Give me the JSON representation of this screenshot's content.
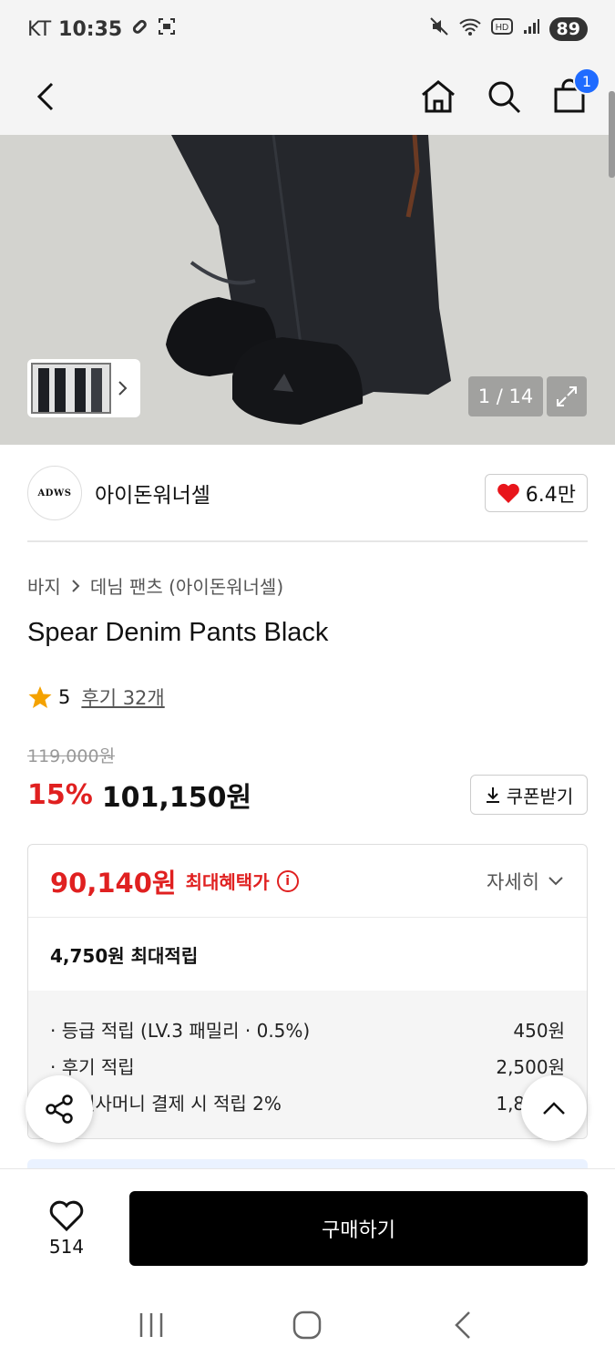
{
  "status": {
    "carrier": "KT",
    "time": "10:35",
    "battery": "89"
  },
  "nav": {
    "cart_count": "1"
  },
  "gallery": {
    "counter": "1 / 14"
  },
  "brand": {
    "logo_text": "ADWS",
    "name": "아이돈워너셀",
    "likes": "6.4만"
  },
  "breadcrumb": {
    "category": "바지",
    "sub": "데님 팬츠 (아이돈워너셀)"
  },
  "product": {
    "title": "Spear Denim Pants Black",
    "rating": "5",
    "reviews": "후기 32개"
  },
  "price": {
    "original": "119,000원",
    "discount": "15%",
    "sale": "101,150원",
    "coupon_label": "쿠폰받기"
  },
  "benefit": {
    "max_price": "90,140원",
    "max_label": "최대혜택가",
    "detail_label": "자세히",
    "points_total": "4,750원 최대적립",
    "items": [
      {
        "label": "· 등급 적립 (LV.3 패밀리 · 0.5%)",
        "value": "450원"
      },
      {
        "label": "· 후기 적립",
        "value": "2,500원"
      },
      {
        "label": "· 무신사머니 결제 시 적립 2%",
        "value": "1,800원"
      }
    ]
  },
  "bottom": {
    "wish_count": "514",
    "buy_label": "구매하기"
  }
}
